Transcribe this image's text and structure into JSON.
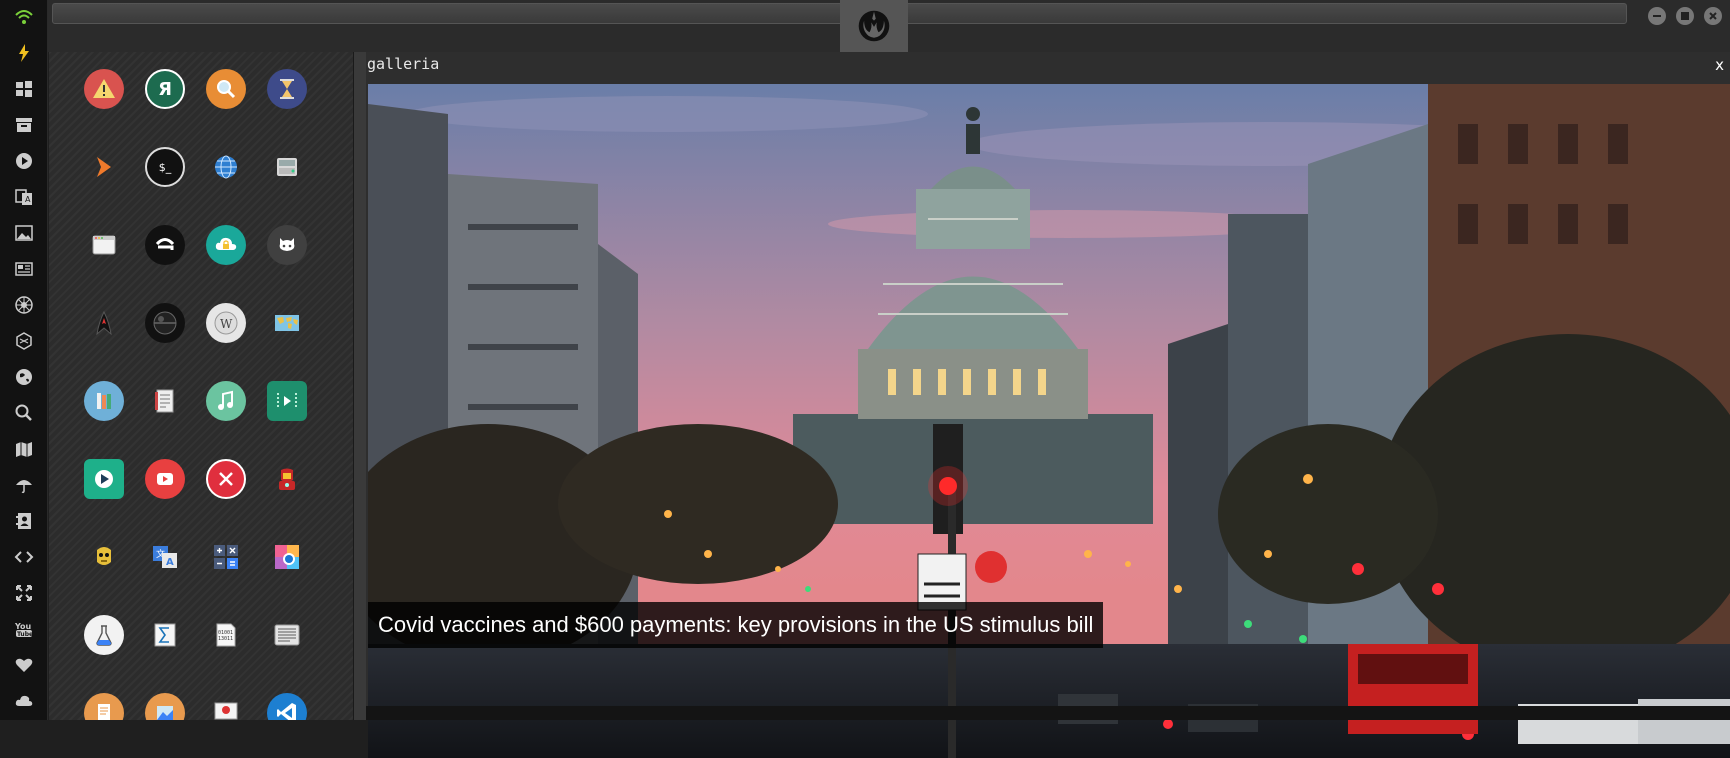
{
  "dock": {
    "items": [
      {
        "name": "wifi-icon"
      },
      {
        "name": "lightning-icon"
      },
      {
        "name": "windows-icon"
      },
      {
        "name": "archive-icon"
      },
      {
        "name": "play-circle-icon"
      },
      {
        "name": "translate-icon"
      },
      {
        "name": "image-icon"
      },
      {
        "name": "newspaper-icon"
      },
      {
        "name": "galactic-empire-icon"
      },
      {
        "name": "hexagon-icon"
      },
      {
        "name": "globe-icon"
      },
      {
        "name": "search-icon"
      },
      {
        "name": "map-icon"
      },
      {
        "name": "umbrella-icon"
      },
      {
        "name": "contacts-icon"
      },
      {
        "name": "code-icon"
      },
      {
        "name": "expand-icon"
      },
      {
        "name": "youtube-icon"
      },
      {
        "name": "heart-icon"
      },
      {
        "name": "cloud-icon"
      }
    ]
  },
  "topbar": {
    "center_icon": "rebel-alliance-icon",
    "controls": [
      "minimize-icon",
      "maximize-icon",
      "close-icon"
    ]
  },
  "drawer": {
    "apps": [
      {
        "name": "alert-app-icon"
      },
      {
        "name": "yandex-app-icon",
        "glyph": "Я"
      },
      {
        "name": "search-app-icon"
      },
      {
        "name": "hourglass-app-icon"
      },
      {
        "name": "arrow-app-icon"
      },
      {
        "name": "terminal-app-icon",
        "glyph": "$_"
      },
      {
        "name": "globe-app-icon"
      },
      {
        "name": "drive-app-icon"
      },
      {
        "name": "window-app-icon"
      },
      {
        "name": "chat-app-icon"
      },
      {
        "name": "cloud-lock-app-icon"
      },
      {
        "name": "github-app-icon"
      },
      {
        "name": "starfleet-app-icon"
      },
      {
        "name": "death-star-app-icon"
      },
      {
        "name": "wikipedia-app-icon"
      },
      {
        "name": "world-map-app-icon"
      },
      {
        "name": "library-app-icon"
      },
      {
        "name": "notebook-app-icon"
      },
      {
        "name": "music-app-icon"
      },
      {
        "name": "video-app-icon"
      },
      {
        "name": "media-player-app-icon"
      },
      {
        "name": "youtube-app-icon"
      },
      {
        "name": "cancel-app-icon"
      },
      {
        "name": "iron-man-app-icon"
      },
      {
        "name": "c3po-app-icon"
      },
      {
        "name": "translate-app-icon"
      },
      {
        "name": "calculator-app-icon"
      },
      {
        "name": "browser-app-icon"
      },
      {
        "name": "chemistry-app-icon"
      },
      {
        "name": "sigma-app-icon"
      },
      {
        "name": "binary-app-icon",
        "glyph": "01001"
      },
      {
        "name": "text-editor-app-icon"
      },
      {
        "name": "document-app-icon"
      },
      {
        "name": "photo-app-icon"
      },
      {
        "name": "presentation-app-icon"
      },
      {
        "name": "vscode-app-icon"
      }
    ]
  },
  "gallery": {
    "title": "galleria",
    "close_label": "x",
    "caption": "Covid vaccines and $600 payments: key provisions in the US stimulus bill",
    "photo_description": "US Capitol at dusk"
  }
}
